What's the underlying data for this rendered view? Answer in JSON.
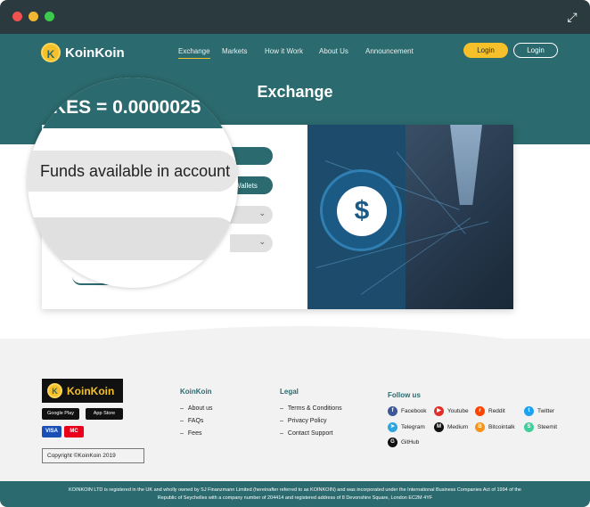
{
  "window": {
    "expand_icon": "expand-icon"
  },
  "brand": {
    "name": "KoinKoin",
    "coin_glyph": "K"
  },
  "nav": {
    "items": [
      {
        "label": "Exchange",
        "active": true
      },
      {
        "label": "Markets"
      },
      {
        "label": "How it Work"
      },
      {
        "label": "About Us"
      },
      {
        "label": "Announcement"
      }
    ],
    "login_primary": "Login",
    "login_secondary": "Login"
  },
  "hero": {
    "title": "Exchange"
  },
  "form": {
    "rate_text": "KES = 0.0000025",
    "funds_label": "Funds available in account",
    "wallets_label": "Wallets",
    "chevron": "chevron-down-icon"
  },
  "image": {
    "money_glyph": "$"
  },
  "footer": {
    "logo_name": "KoinKoin",
    "google_play": "Google Play",
    "app_store": "App Store",
    "visa": "VISA",
    "mastercard": "MC",
    "copyright": "Copyright ©KoinKoin 2019",
    "columns": [
      {
        "title": "KoinKoin",
        "links": [
          "About us",
          "FAQs",
          "Fees"
        ]
      },
      {
        "title": "Legal",
        "links": [
          "Terms & Conditions",
          "Privacy Policy",
          "Contact Support"
        ]
      }
    ],
    "follow_title": "Follow us",
    "social": [
      {
        "label": "Facebook",
        "color": "#3b5998",
        "glyph": "f"
      },
      {
        "label": "Youtube",
        "color": "#e52d27",
        "glyph": "▶"
      },
      {
        "label": "Reddit",
        "color": "#ff4500",
        "glyph": "r"
      },
      {
        "label": "Twitter",
        "color": "#1da1f2",
        "glyph": "t"
      },
      {
        "label": "Telegram",
        "color": "#2ca5e0",
        "glyph": "➤"
      },
      {
        "label": "Medium",
        "color": "#111111",
        "glyph": "M"
      },
      {
        "label": "Bitcointalk",
        "color": "#f7931a",
        "glyph": "B"
      },
      {
        "label": "Steemit",
        "color": "#3fcf9a",
        "glyph": "S"
      },
      {
        "label": "GitHub",
        "color": "#111111",
        "glyph": "G"
      }
    ]
  },
  "legal": {
    "line1": "KOINKOIN LTD is registered in the UK and wholly owned by SJ Finanzmann Limited (hereinafter referred to as KOINKOIN) and was incorporated under the International Business Companies Act of 1994 of the",
    "line2": "Republic of Seychelles with a company number of 204414 and registered address of 8 Devonshire Square, London EC2M 4YF"
  },
  "colors": {
    "primary": "#2b6a6e",
    "accent": "#f5c02a"
  }
}
